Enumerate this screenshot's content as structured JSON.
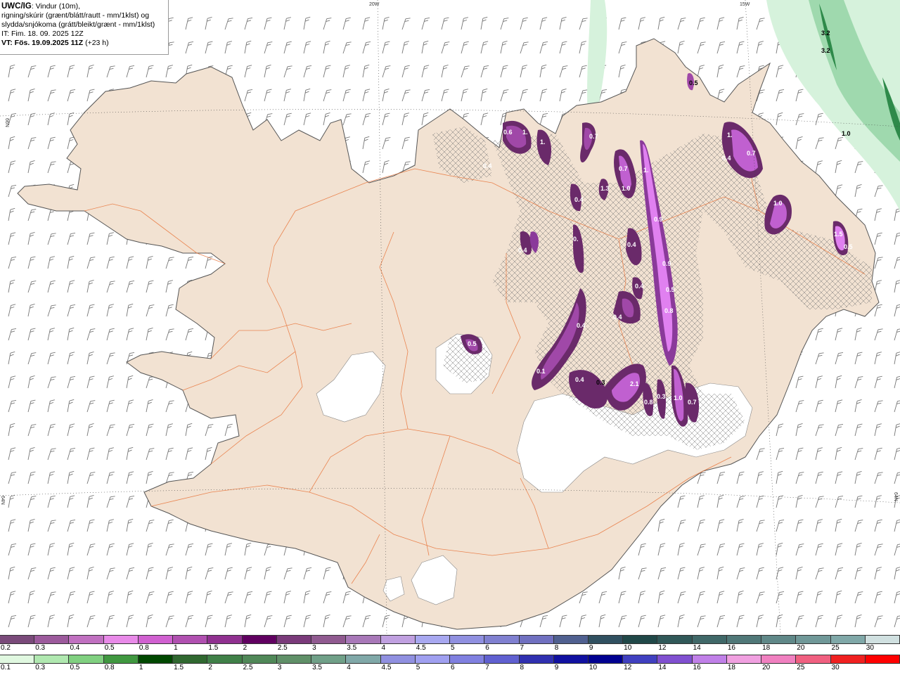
{
  "info": {
    "title": "UWC/IG",
    "line1": ": Vindur (10m),",
    "line2": "rigning/skúrir (grænt/blátt/rautt - mm/1klst) og",
    "line3": "slydda/snjókoma (grátt/bleikt/grænt - mm/1klst)",
    "it": "IT: Fim. 18. 09. 2025 12Z",
    "vt_label": "VT: Fös. 19.09.2025 11Z",
    "vt_offset": " (+23 h)"
  },
  "grid_labels": {
    "top_20w": "20W",
    "top_15w": "15W",
    "left_66n": "66N",
    "left_64n": "64N",
    "right_64n": "64N"
  },
  "map_values": [
    "0.6",
    "1.",
    "1.",
    "0.7",
    "0.7",
    "1.3",
    "1.0",
    "1.",
    "0.4",
    "0.4",
    "0.4",
    "0.",
    "0.9",
    "0.4",
    "0.9",
    "0.4",
    "0.5",
    "0.4",
    "0.8",
    "0.4",
    "0.5",
    "0.1",
    "0.4",
    "0.3",
    "2.1",
    "0.8",
    "0.3",
    "1.0",
    "0.7",
    "0.5",
    "1.",
    "0.4",
    "0.7",
    "1.0",
    "1.5",
    "0.5",
    "3.2",
    "3.2",
    "1.0"
  ],
  "legend_top": {
    "colors": [
      "#7a4a7a",
      "#9c5a9c",
      "#c070c0",
      "#e88ae8",
      "#d060d0",
      "#b050b0",
      "#903090",
      "#600060",
      "#7a3a7a",
      "#905a90",
      "#a878b8",
      "#c0a0e0",
      "#a8a8f0",
      "#9090e0",
      "#8080d0",
      "#7070c0",
      "#506090",
      "#305060",
      "#204848",
      "#305858",
      "#406868",
      "#507878",
      "#608888",
      "#709898",
      "#80a8a8",
      "#d0e0e0"
    ],
    "labels": [
      "0.2",
      "0.3",
      "0.4",
      "0.5",
      "0.8",
      "1",
      "1.5",
      "2",
      "2.5",
      "3",
      "3.5",
      "4",
      "4.5",
      "5",
      "6",
      "7",
      "8",
      "9",
      "10",
      "12",
      "14",
      "16",
      "18",
      "20",
      "25",
      "30"
    ]
  },
  "legend_bottom": {
    "colors": [
      "#e0f8e0",
      "#b0e8b0",
      "#80d080",
      "#409840",
      "#004800",
      "#306830",
      "#408048",
      "#508858",
      "#609068",
      "#70a088",
      "#80a8a8",
      "#9090e0",
      "#a0a0f0",
      "#8080e0",
      "#6060d0",
      "#3030b0",
      "#1010a0",
      "#000090",
      "#4040c0",
      "#8050d0",
      "#c080e8",
      "#f0a0e0",
      "#f080c0",
      "#f06080",
      "#f02020",
      "#ff0000"
    ],
    "labels": [
      "0.1",
      "0.3",
      "0.5",
      "0.8",
      "1",
      "1.5",
      "2",
      "2.5",
      "3",
      "3.5",
      "4",
      "4.5",
      "5",
      "6",
      "7",
      "8",
      "9",
      "10",
      "12",
      "14",
      "16",
      "18",
      "20",
      "25",
      "30"
    ]
  },
  "colors": {
    "land": "#f2e2d2",
    "coast": "#555555",
    "roads": "#e8743a",
    "glacier": "#ffffff",
    "snow_heavy": "#6a2a6a",
    "snow_mid": "#a048a8",
    "snow_light": "#e080f0",
    "rain_green": "#2e8a4a"
  }
}
